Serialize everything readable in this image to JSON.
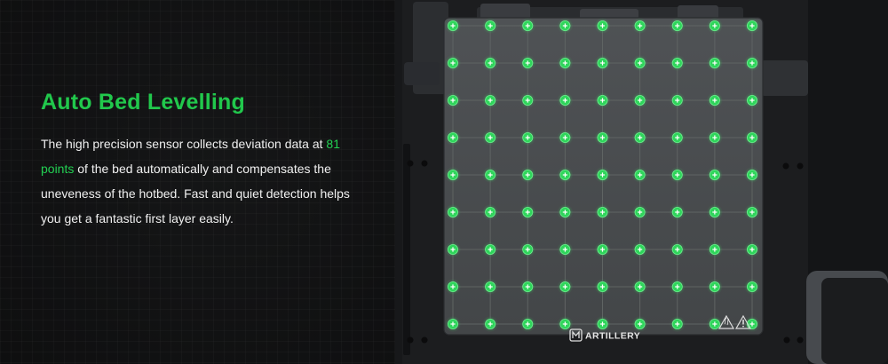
{
  "headline": "Auto Bed Levelling",
  "description": {
    "part1": "The high precision sensor collects deviation data at ",
    "highlight": "81 points",
    "part2": " of the bed automatically and compensates the uneveness of the hotbed. Fast and quiet detection helps you get a fantastic first layer easily."
  },
  "brand": {
    "name": "ARTILLERY",
    "logo_icon": "artillery-logo-icon"
  },
  "colors": {
    "accent": "#21c84c",
    "background": "#0b0b0c",
    "text": "#f0f0f0"
  }
}
